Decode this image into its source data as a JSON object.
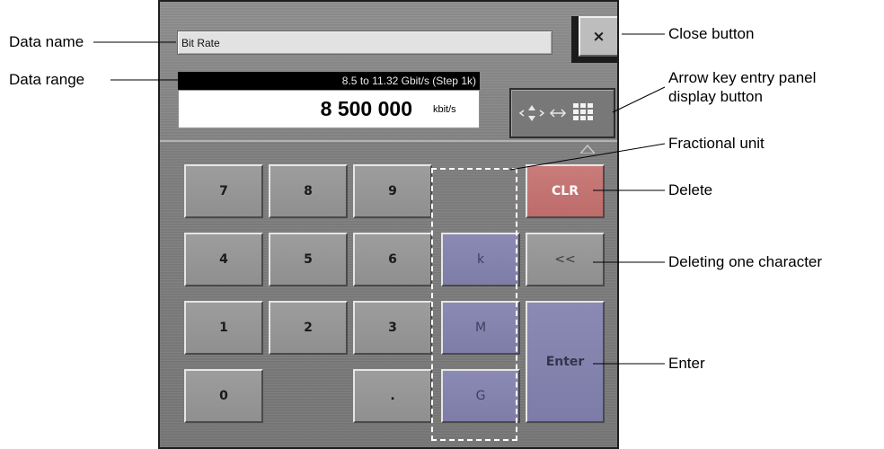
{
  "keypad": {
    "data_name": "Bit Rate",
    "data_range": "8.5 to 11.32 Gbit/s (Step 1k)",
    "value": "8 500 000",
    "unit": "kbit/s",
    "close_label": "×",
    "keys": {
      "k7": "7",
      "k8": "8",
      "k9": "9",
      "k4": "4",
      "k5": "5",
      "k6": "6",
      "k1": "1",
      "k2": "2",
      "k3": "3",
      "k0": "0",
      "dot": ".",
      "kilo": "k",
      "mega": "M",
      "giga": "G",
      "clr": "CLR",
      "backspace": "<<",
      "enter": "Enter"
    },
    "colors": {
      "unit_key": "#8584ae",
      "clr_key": "#c47472",
      "panel": "#808080"
    }
  },
  "callouts": {
    "data_name": "Data  name",
    "data_range": "Data  range",
    "close_button": "Close button",
    "arrow_panel_line1": "Arrow key entry panel",
    "arrow_panel_line2": "display button",
    "fractional_unit": "Fractional unit",
    "delete": "Delete",
    "delete_one_char": "Deleting one character",
    "enter": "Enter"
  }
}
